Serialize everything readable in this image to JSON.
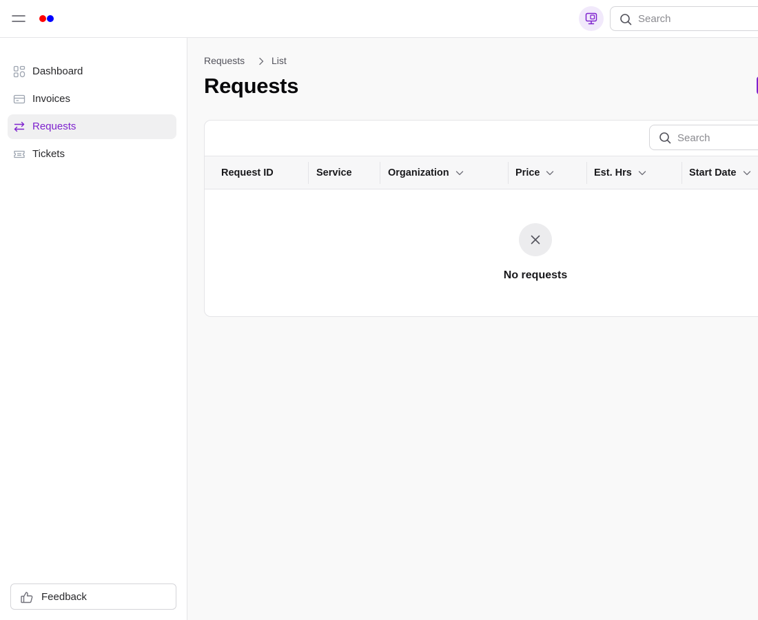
{
  "colors": {
    "accent": "#7e22ce",
    "accent_soft": "#f1e9fb",
    "logo_red": "#ff0000",
    "logo_blue": "#0000ff",
    "primary_button": "#7e22ce"
  },
  "topbar": {
    "menu_icon": "hamburger-icon",
    "monitor_icon": "monitor-icon",
    "search": {
      "placeholder": "Search",
      "value": ""
    }
  },
  "sidebar": {
    "items": [
      {
        "label": "Dashboard",
        "icon": "dashboard-icon",
        "active": false
      },
      {
        "label": "Invoices",
        "icon": "invoice-icon",
        "active": false
      },
      {
        "label": "Requests",
        "icon": "arrows-swap-icon",
        "active": true
      },
      {
        "label": "Tickets",
        "icon": "ticket-icon",
        "active": false
      }
    ],
    "feedback": {
      "label": "Feedback",
      "icon": "thumbs-up-icon"
    }
  },
  "main": {
    "breadcrumb": [
      "Requests",
      "List"
    ],
    "title": "Requests",
    "table": {
      "search": {
        "placeholder": "Search",
        "value": ""
      },
      "columns": [
        {
          "label": "Request ID",
          "sortable": false
        },
        {
          "label": "Service",
          "sortable": false
        },
        {
          "label": "Organization",
          "sortable": true
        },
        {
          "label": "Price",
          "sortable": true
        },
        {
          "label": "Est. Hrs",
          "sortable": true
        },
        {
          "label": "Start Date",
          "sortable": true
        }
      ],
      "rows": [],
      "empty": {
        "icon": "close-icon",
        "text": "No requests"
      }
    }
  }
}
